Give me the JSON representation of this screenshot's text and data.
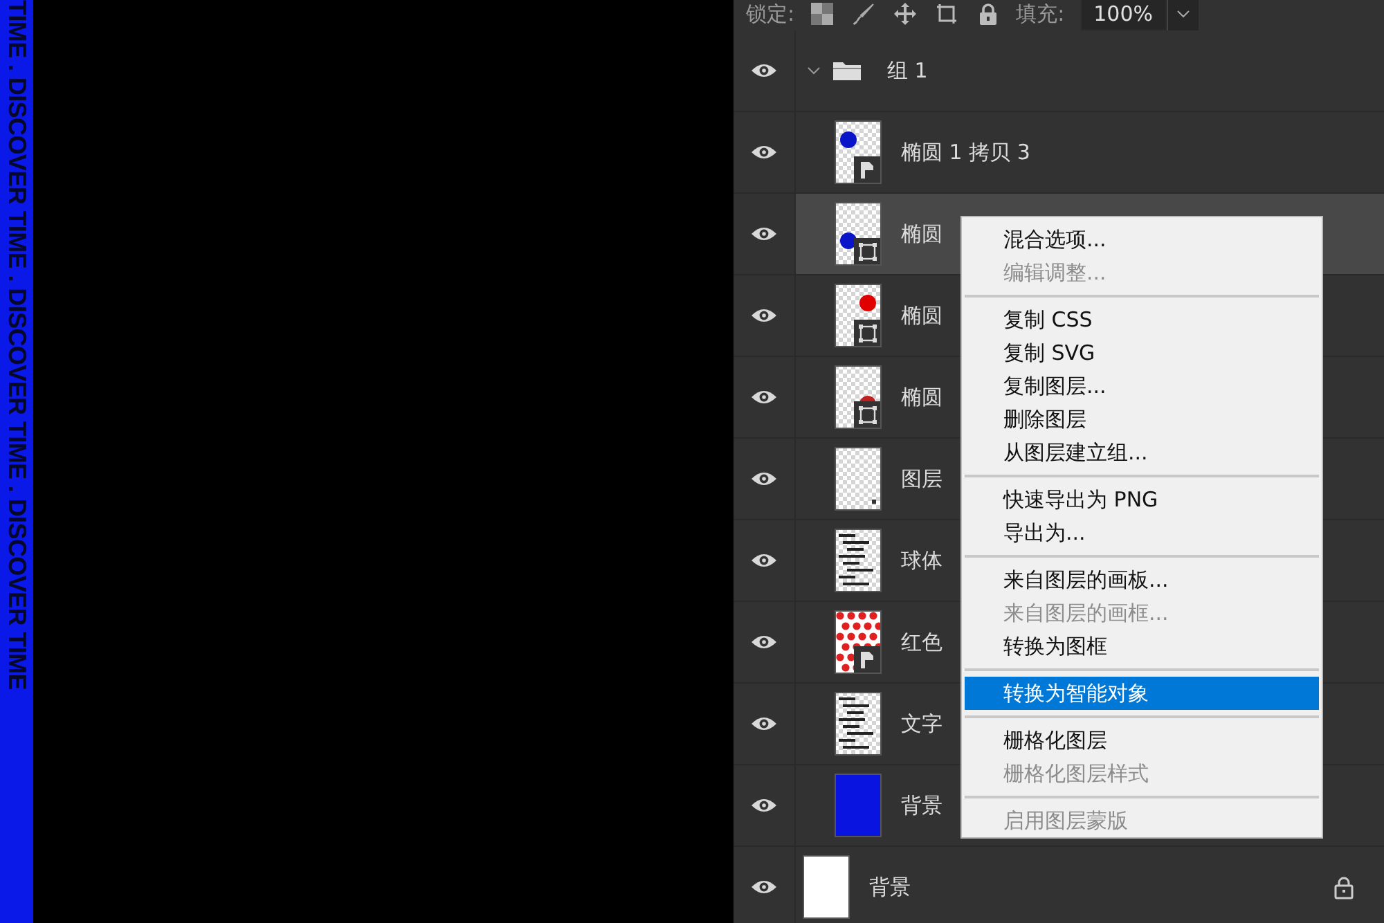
{
  "canvas": {
    "strip_text": "TIME . DISCOVER TIME . DISCOVER TIME . DISCOVER TIME"
  },
  "toolbar": {
    "lock_label": "锁定:",
    "fill_label": "填充:",
    "fill_value": "100%"
  },
  "layers": [
    {
      "name": "组 1",
      "kind": "group",
      "visible": true,
      "selected": false,
      "expanded": true,
      "children": [
        {
          "name": "椭圆 1 拷贝 3",
          "kind": "layer",
          "visible": true,
          "selected": false,
          "thumb": {
            "kind": "smart-dot-left",
            "color": "#0a14c8"
          }
        },
        {
          "name": "椭圆",
          "kind": "layer",
          "visible": true,
          "selected": true,
          "thumb": {
            "kind": "shape-dot-left",
            "color": "#0a14c8"
          }
        },
        {
          "name": "椭圆",
          "kind": "layer",
          "visible": true,
          "selected": false,
          "thumb": {
            "kind": "shape-dot-right",
            "color": "#e00000"
          }
        },
        {
          "name": "椭圆",
          "kind": "layer",
          "visible": true,
          "selected": false,
          "thumb": {
            "kind": "shape-dot-low",
            "color": "#c02020"
          }
        },
        {
          "name": "图层",
          "kind": "layer",
          "visible": true,
          "selected": false,
          "thumb": {
            "kind": "plain"
          }
        },
        {
          "name": "球体",
          "kind": "layer",
          "visible": true,
          "selected": false,
          "thumb": {
            "kind": "text"
          }
        },
        {
          "name": "红色",
          "kind": "layer",
          "visible": true,
          "selected": false,
          "thumb": {
            "kind": "smart-dots",
            "color": "#e02020"
          }
        },
        {
          "name": "文字",
          "kind": "layer",
          "visible": true,
          "selected": false,
          "thumb": {
            "kind": "text"
          }
        },
        {
          "name": "背景",
          "kind": "layer",
          "visible": true,
          "selected": false,
          "thumb": {
            "kind": "fill",
            "color": "#0a14e0"
          }
        }
      ]
    },
    {
      "name": "背景",
      "kind": "background",
      "visible": true,
      "selected": false,
      "locked": true,
      "thumb": {
        "kind": "fill",
        "color": "#ffffff"
      }
    }
  ],
  "context_menu": {
    "groups": [
      [
        {
          "label": "混合选项...",
          "disabled": false,
          "selected": false
        },
        {
          "label": "编辑调整...",
          "disabled": true,
          "selected": false
        }
      ],
      [
        {
          "label": "复制 CSS",
          "disabled": false,
          "selected": false
        },
        {
          "label": "复制 SVG",
          "disabled": false,
          "selected": false
        },
        {
          "label": "复制图层...",
          "disabled": false,
          "selected": false
        },
        {
          "label": "删除图层",
          "disabled": false,
          "selected": false
        },
        {
          "label": "从图层建立组...",
          "disabled": false,
          "selected": false
        }
      ],
      [
        {
          "label": "快速导出为 PNG",
          "disabled": false,
          "selected": false
        },
        {
          "label": "导出为...",
          "disabled": false,
          "selected": false
        }
      ],
      [
        {
          "label": "来自图层的画板...",
          "disabled": false,
          "selected": false
        },
        {
          "label": "来自图层的画框...",
          "disabled": true,
          "selected": false
        },
        {
          "label": "转换为图框",
          "disabled": false,
          "selected": false
        }
      ],
      [
        {
          "label": "转换为智能对象",
          "disabled": false,
          "selected": true
        }
      ],
      [
        {
          "label": "栅格化图层",
          "disabled": false,
          "selected": false
        },
        {
          "label": "栅格化图层样式",
          "disabled": true,
          "selected": false
        }
      ],
      [
        {
          "label": "启用图层蒙版",
          "disabled": true,
          "selected": false
        }
      ]
    ]
  }
}
